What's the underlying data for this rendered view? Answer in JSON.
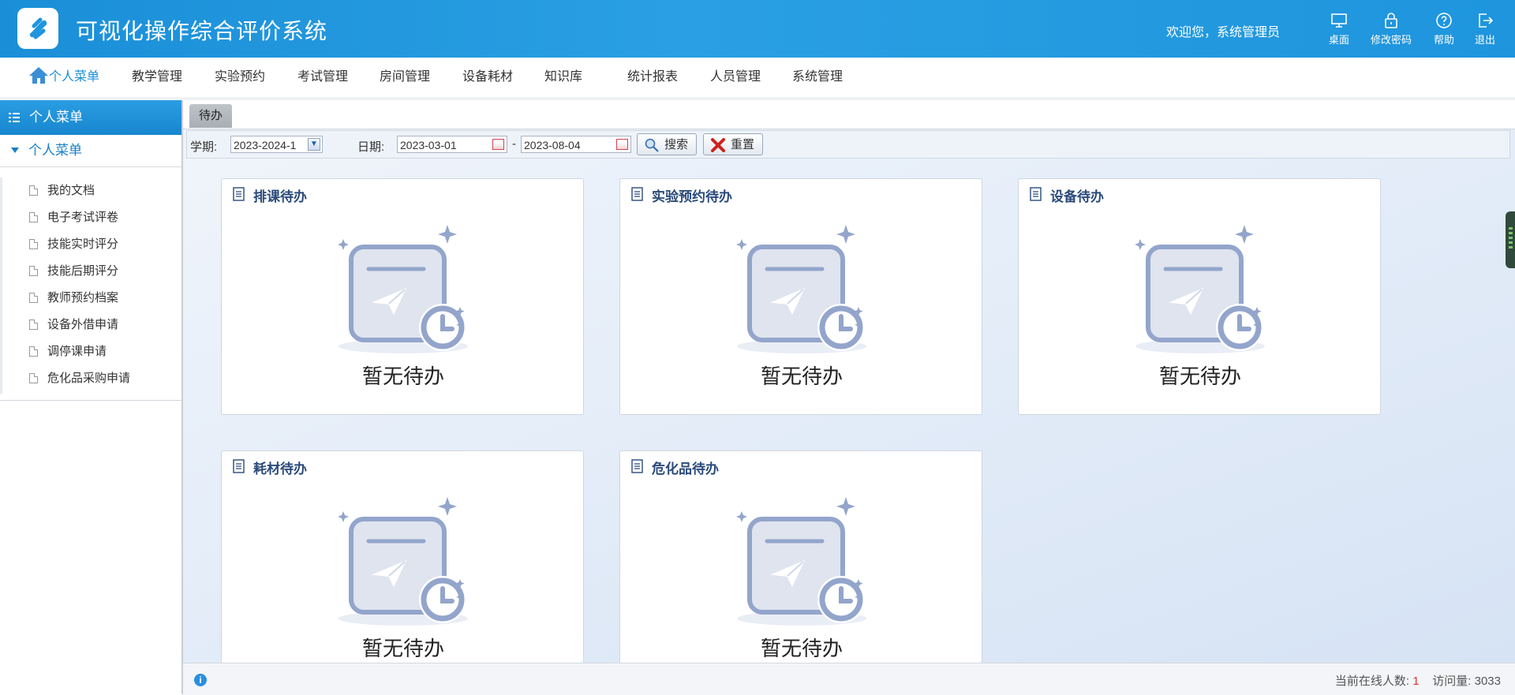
{
  "header": {
    "title": "可视化操作综合评价系统",
    "welcome": "欢迎您，系统管理员",
    "buttons": [
      {
        "label": "桌面",
        "icon": "desktop-icon"
      },
      {
        "label": "修改密码",
        "icon": "lock-icon"
      },
      {
        "label": "帮助",
        "icon": "help-icon"
      },
      {
        "label": "退出",
        "icon": "logout-icon"
      }
    ]
  },
  "nav": {
    "items": [
      "个人菜单",
      "教学管理",
      "实验预约",
      "考试管理",
      "房间管理",
      "设备耗材",
      "知识库",
      "统计报表",
      "人员管理",
      "系统管理"
    ]
  },
  "sidebar": {
    "header": "个人菜单",
    "group": "个人菜单",
    "items": [
      "我的文档",
      "电子考试评卷",
      "技能实时评分",
      "技能后期评分",
      "教师预约档案",
      "设备外借申请",
      "调停课申请",
      "危化品采购申请"
    ]
  },
  "tabs": [
    "待办"
  ],
  "filter": {
    "term_label": "学期:",
    "term_value": "2023-2024-1",
    "date_label": "日期:",
    "date_from": "2023-03-01",
    "date_sep": "-",
    "date_to": "2023-08-04",
    "search_label": "搜索",
    "reset_label": "重置"
  },
  "cards": [
    {
      "title": "排课待办",
      "empty": "暂无待办"
    },
    {
      "title": "实验预约待办",
      "empty": "暂无待办"
    },
    {
      "title": "设备待办",
      "empty": "暂无待办"
    },
    {
      "title": "耗材待办",
      "empty": "暂无待办"
    },
    {
      "title": "危化品待办",
      "empty": "暂无待办"
    }
  ],
  "status": {
    "online_label": "当前在线人数:",
    "online_count": "1",
    "visits_label": "访问量:",
    "visits_count": "3033"
  },
  "colors": {
    "accent": "#1a8fd8",
    "card_title": "#2a4a7a",
    "illustration": "#8fa3c9"
  }
}
